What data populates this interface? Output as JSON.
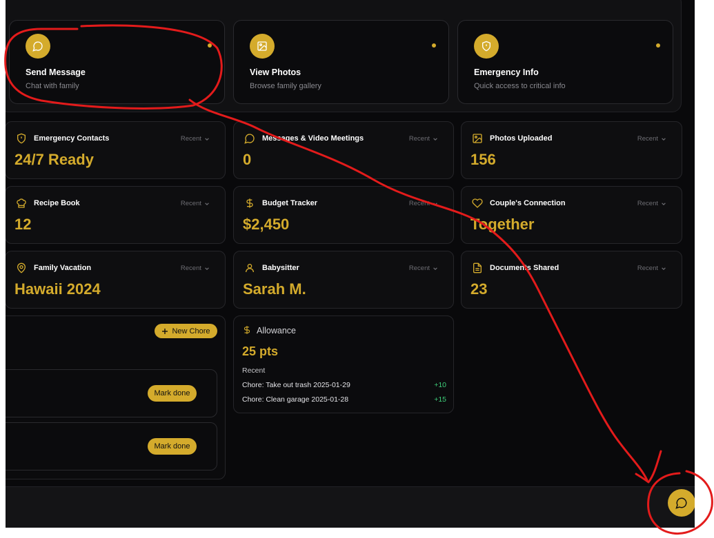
{
  "quick_actions": [
    {
      "title": "Send Message",
      "subtitle": "Chat with family",
      "icon": "chat-icon"
    },
    {
      "title": "View Photos",
      "subtitle": "Browse family gallery",
      "icon": "image-icon"
    },
    {
      "title": "Emergency Info",
      "subtitle": "Quick access to critical info",
      "icon": "shield-icon"
    }
  ],
  "stats": [
    {
      "title": "Emergency Contacts",
      "value": "24/7 Ready",
      "filter": "Recent",
      "icon": "shield-icon"
    },
    {
      "title": "Messages & Video Meetings",
      "value": "0",
      "filter": "Recent",
      "icon": "chat-icon"
    },
    {
      "title": "Photos Uploaded",
      "value": "156",
      "filter": "Recent",
      "icon": "image-icon"
    },
    {
      "title": "Recipe Book",
      "value": "12",
      "filter": "Recent",
      "icon": "chef-hat-icon"
    },
    {
      "title": "Budget Tracker",
      "value": "$2,450",
      "filter": "Recent",
      "icon": "dollar-icon"
    },
    {
      "title": "Couple's Connection",
      "value": "Together",
      "filter": "Recent",
      "icon": "heart-icon"
    },
    {
      "title": "Family Vacation",
      "value": "Hawaii 2024",
      "filter": "Recent",
      "icon": "map-pin-icon"
    },
    {
      "title": "Babysitter",
      "value": "Sarah M.",
      "filter": "Recent",
      "icon": "user-icon"
    },
    {
      "title": "Documents Shared",
      "value": "23",
      "filter": "Recent",
      "icon": "document-icon"
    }
  ],
  "chores": {
    "new_button_label": "New Chore",
    "items": [
      {
        "action_label": "Mark done"
      },
      {
        "action_label": "Mark done"
      }
    ]
  },
  "allowance": {
    "title": "Allowance",
    "points": "25 pts",
    "recent_label": "Recent",
    "transactions": [
      {
        "label": "Chore: Take out trash 2025-01-29",
        "amount": "+10"
      },
      {
        "label": "Chore: Clean garage 2025-01-28",
        "amount": "+15"
      }
    ]
  },
  "colors": {
    "accent": "#d4ab2c",
    "background": "#09090b",
    "card": "#0e0e10",
    "positive": "#3ecf7a",
    "annotation": "#e31b1b"
  }
}
